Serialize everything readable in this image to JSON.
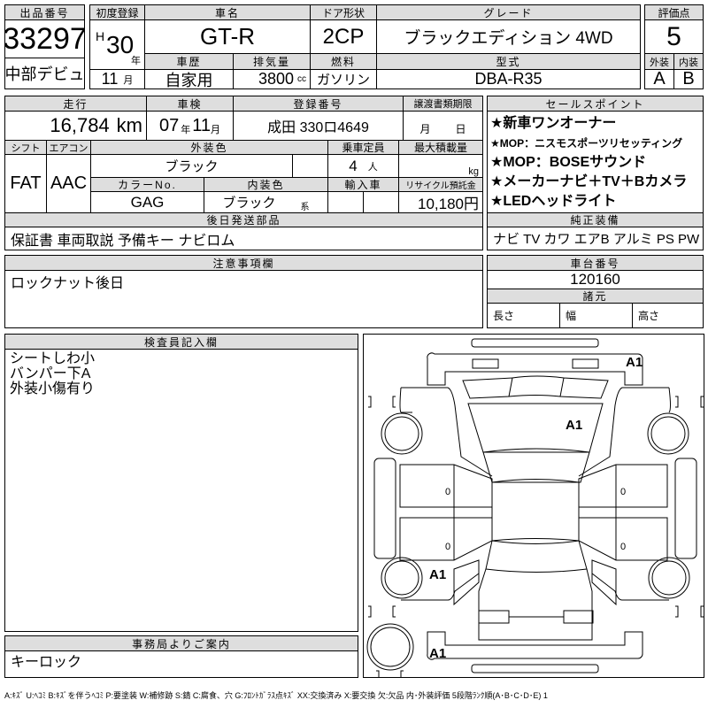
{
  "lot": {
    "label": "出品番号",
    "number": "33297",
    "venue": "中部デビュ"
  },
  "header": {
    "first_reg_label": "初度登録",
    "era": "H",
    "year": "30",
    "year_unit": "年",
    "month": "11",
    "month_unit": "月",
    "car_name_label": "車名",
    "car_name": "GT-R",
    "door_label": "ドア形状",
    "door": "2CP",
    "grade_label": "グレード",
    "grade": "ブラックエディション 4WD",
    "history_label": "車歴",
    "history": "自家用",
    "displacement_label": "排気量",
    "displacement": "3800",
    "displacement_unit": "cc",
    "fuel_label": "燃料",
    "fuel": "ガソリン",
    "model_label": "型式",
    "model": "DBA-R35"
  },
  "score": {
    "label": "評価点",
    "value": "5",
    "exterior_label": "外装",
    "interior_label": "内装",
    "exterior": "A",
    "interior": "B"
  },
  "details": {
    "mileage_label": "走行",
    "mileage": "16,784",
    "mileage_unit": "km",
    "inspection_label": "車検",
    "inspection_year": "07",
    "inspection_year_unit": "年",
    "inspection_month": "11",
    "inspection_month_unit": "月",
    "plate_label": "登録番号",
    "plate": "成田 330ロ4649",
    "transfer_label": "譲渡書類期限",
    "transfer_month_unit": "月",
    "transfer_day_unit": "日",
    "shift_label": "シフト",
    "shift": "FAT",
    "ac_label": "エアコン",
    "ac": "AAC",
    "ext_color_label": "外装色",
    "ext_color": "ブラック",
    "capacity_label": "乗車定員",
    "capacity": "4",
    "capacity_unit": "人",
    "load_label": "最大積載量",
    "load_unit": "kg",
    "color_no_label": "カラーNo.",
    "color_no": "GAG",
    "int_color_label": "内装色",
    "int_color": "ブラック",
    "int_color_suffix": "系",
    "import_label": "輸入車",
    "recycle_label": "リサイクル預託金",
    "recycle": "10,180円",
    "parts_label": "後日発送部品",
    "parts": "保証書 車両取説 予備キー ナビロム"
  },
  "sales_points": {
    "label": "セールスポイント",
    "items": [
      "★新車ワンオーナー",
      "★MOP：ニスモスポーツリセッティング",
      "★MOP：BOSEサウンド",
      "★メーカーナビ＋TV＋Bカメラ",
      "★LEDヘッドライト"
    ]
  },
  "equipment": {
    "label": "純正装備",
    "value": "ナビ TV カワ エアB アルミ PS PW"
  },
  "notes": {
    "label": "注意事項欄",
    "value": "ロックナット後日"
  },
  "chassis": {
    "label": "車台番号",
    "value": "120160",
    "spec_label": "諸元",
    "length_label": "長さ",
    "width_label": "幅",
    "height_label": "高さ"
  },
  "inspector": {
    "label": "検査員記入欄",
    "lines": [
      "シートしわ小",
      "バンパー下A",
      "外装小傷有り"
    ]
  },
  "office": {
    "label": "事務局よりご案内",
    "value": "キーロック"
  },
  "diagram": {
    "marks": [
      "A1",
      "A1",
      "A1",
      "A1"
    ],
    "zeros": [
      "0",
      "0",
      "0",
      "0"
    ]
  },
  "footer": "A:ｷｽﾞ U:ﾍｺﾐ B:ｷｽﾞを伴うﾍｺﾐ P:要塗装 W:補修跡 S:錆 C:腐食、穴 G:ﾌﾛﾝﾄｶﾞﾗｽ点ｷｽﾞ XX:交換済み X:要交換 欠:欠品 内･外装評価 5段階ﾗﾝｸ順(A･B･C･D･E) 1"
}
